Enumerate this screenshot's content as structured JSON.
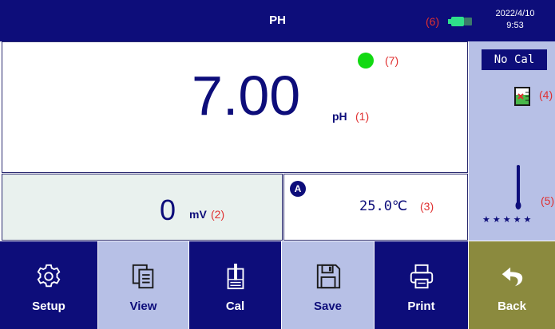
{
  "header": {
    "title": "PH",
    "marker": "(6)",
    "battery_icon": "battery-icon",
    "date": "2022/4/10",
    "time": "9:53"
  },
  "measurement": {
    "value": "7.00",
    "unit": "pH",
    "marker": "(1)",
    "status_marker": "(7)",
    "status_color": "#12d912"
  },
  "side_panel": {
    "cal_status": "No Cal",
    "beaker_marker": "(4)",
    "probe_marker": "(5)",
    "stars": "★★★★★"
  },
  "mv": {
    "value": "0",
    "unit": "mV",
    "marker": "(2)"
  },
  "temperature": {
    "mode_badge": "A",
    "value": "25.0℃",
    "marker": "(3)"
  },
  "toolbar": {
    "setup": "Setup",
    "view": "View",
    "cal": "Cal",
    "save": "Save",
    "print": "Print",
    "back": "Back"
  },
  "colors": {
    "primary": "#0d0d7a",
    "light": "#b7c0e6",
    "back": "#8b8a3e",
    "marker": "#e03030"
  }
}
